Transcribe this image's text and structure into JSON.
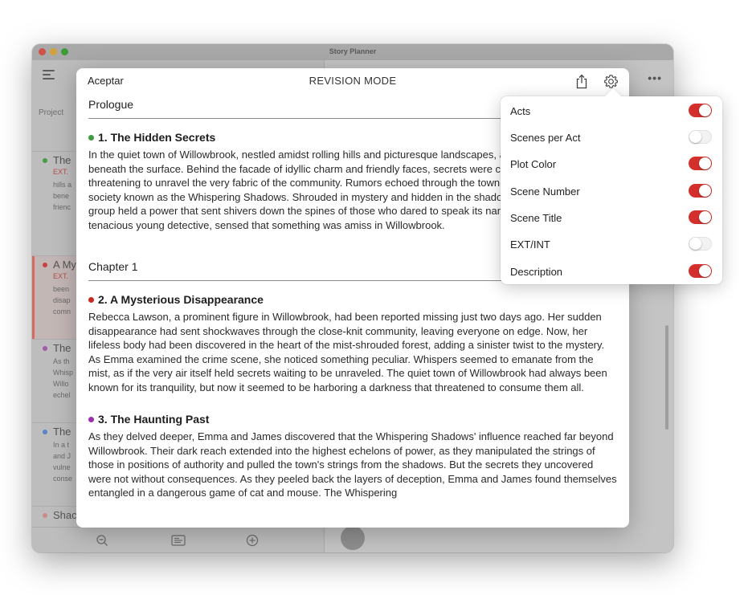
{
  "window": {
    "title": "Story Planner"
  },
  "sidebar": {
    "section_label": "Project",
    "cards": [
      {
        "title": "The",
        "ext": "EXT.",
        "desc": [
          "hills a",
          "bene",
          "frienc"
        ],
        "color": "#4a9a4a"
      },
      {
        "title": "A My",
        "ext": "EXT.",
        "desc": [
          "been",
          "disap",
          "comn"
        ],
        "color": "#c94040"
      },
      {
        "title": "The",
        "ext": "",
        "desc": [
          "As th",
          "Whisp",
          "Willo",
          "echel"
        ],
        "color": "#a05aa8"
      },
      {
        "title": "The",
        "ext": "",
        "desc": [
          "In a t",
          "and J",
          "vulne",
          "conse"
        ],
        "color": "#5a82c8"
      },
      {
        "title": "Shac",
        "ext": "",
        "desc": [],
        "color": "#c98a8a"
      }
    ]
  },
  "sheet": {
    "accept_label": "Aceptar",
    "title": "REVISION MODE",
    "sections": [
      {
        "title": "Prologue",
        "scenes": [
          {
            "heading": "1. The Hidden Secrets",
            "color": "#3f9b3f",
            "body": "In the quiet town of Willowbrook, nestled amidst rolling hills and picturesque landscapes, an unease lingered beneath the surface. Behind the facade of idyllic charm and friendly faces, secrets were carefully concealed, threatening to unravel the very fabric of the community. Rumors echoed through the town, murmurs of a secret society known as the Whispering Shadows. Shrouded in mystery and hidden in the shadows, this clandestine group held a power that sent shivers down the spines of those who dared to speak its name. Emma Reynolds, a tenacious young detective, sensed that something was amiss in Willowbrook."
          }
        ]
      },
      {
        "title": "Chapter 1",
        "scenes": [
          {
            "heading": "2. A Mysterious Disappearance",
            "color": "#c8281f",
            "body": "Rebecca Lawson, a prominent figure in Willowbrook, had been reported missing just two days ago. Her sudden disappearance had sent shockwaves through the close-knit community, leaving everyone on edge. Now, her lifeless body had been discovered in the heart of the mist-shrouded forest, adding a sinister twist to the mystery. As Emma examined the crime scene, she noticed something peculiar. Whispers seemed to emanate from the mist, as if the very air itself held secrets waiting to be unraveled. The quiet town of Willowbrook had always been known for its tranquility, but now it seemed to be harboring a darkness that threatened to consume them all."
          },
          {
            "heading": "3. The Haunting Past",
            "color": "#9b2fae",
            "body": "As they delved deeper, Emma and James discovered that the Whispering Shadows' influence reached far beyond Willowbrook. Their dark reach extended into the highest echelons of power, as they manipulated the strings of those in positions of authority and pulled the town's strings from the shadows. But the secrets they uncovered were not without consequences. As they peeled back the layers of deception, Emma and James found themselves entangled in a dangerous game of cat and mouse. The Whispering"
          }
        ]
      }
    ]
  },
  "settings": {
    "options": [
      {
        "label": "Acts",
        "enabled": true
      },
      {
        "label": "Scenes per Act",
        "enabled": false
      },
      {
        "label": "Plot Color",
        "enabled": true
      },
      {
        "label": "Scene Number",
        "enabled": true
      },
      {
        "label": "Scene Title",
        "enabled": true
      },
      {
        "label": "EXT/INT",
        "enabled": false
      },
      {
        "label": "Description",
        "enabled": true
      }
    ],
    "accent_color": "#d3302d"
  }
}
